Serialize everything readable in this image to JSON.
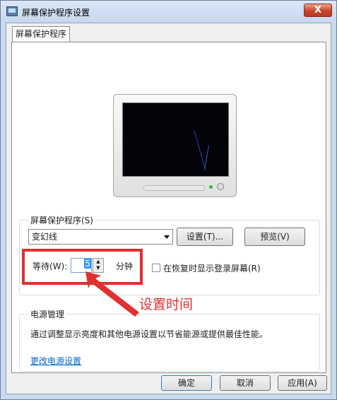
{
  "window": {
    "title": "屏幕保护程序设置",
    "close_label": "X"
  },
  "tab": {
    "label": "屏幕保护程序"
  },
  "screensaver": {
    "group_label": "屏幕保护程序(S)",
    "selected": "变幻线",
    "settings_button": "设置(T)...",
    "preview_button": "预览(V)",
    "wait_label": "等待(W):",
    "wait_value": "5",
    "wait_unit": "分钟",
    "resume_checkbox_label": "在恢复时显示登录屏幕(R)",
    "resume_checked": false
  },
  "annotation": {
    "text": "设置时间",
    "color": "#e03030"
  },
  "power": {
    "group_label": "电源管理",
    "description": "通过调整显示亮度和其他电源设置以节省能源或提供最佳性能。",
    "link": "更改电源设置"
  },
  "footer": {
    "ok_button": "确定",
    "cancel_button": "取消",
    "apply_button": "应用(A)"
  }
}
